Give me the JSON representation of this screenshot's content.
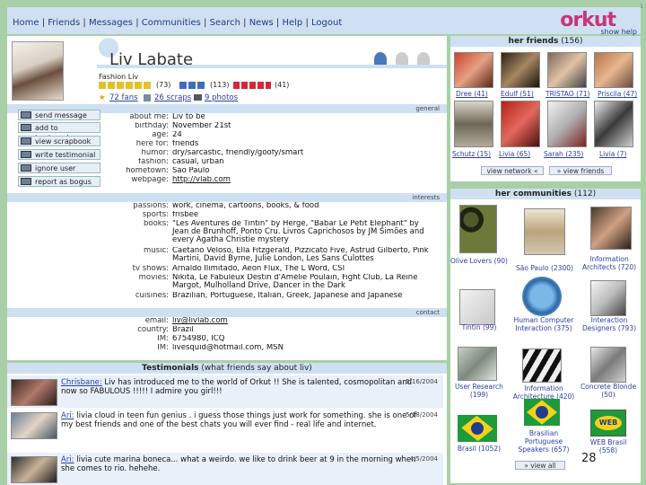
{
  "nav": {
    "items": [
      "Home",
      "Friends",
      "Messages",
      "Communities",
      "Search",
      "News",
      "Help",
      "Logout"
    ],
    "logo": "orkut",
    "help": "show help",
    "side": "1"
  },
  "profile": {
    "name": "Liv Labate",
    "hdr1": "",
    "meta1": "Fashion Liv",
    "fans_count": "(73)",
    "cool_count": "(113)",
    "sexy_count": "(41)",
    "fans": "72 fans",
    "scraps": "26 scraps",
    "photos": "9 photos",
    "section_general": "general",
    "section_interests": "interests",
    "section_contact": "contact"
  },
  "actions": [
    "send message",
    "add to bookmarks",
    "view scrapbook",
    "write testimonial",
    "ignore user",
    "report as bogus"
  ],
  "general": [
    {
      "k": "about me:",
      "v": "Liv to be"
    },
    {
      "k": "birthday:",
      "v": "November 21st"
    },
    {
      "k": "age:",
      "v": "24"
    },
    {
      "k": "here for:",
      "v": "friends"
    },
    {
      "k": "humor:",
      "v": "dry/sarcastic, friendly/goofy/smart"
    },
    {
      "k": "fashion:",
      "v": "casual, urban"
    },
    {
      "k": "hometown:",
      "v": "São Paulo"
    },
    {
      "k": "webpage:",
      "v": "http://vlab.com"
    }
  ],
  "interests": [
    {
      "k": "passions:",
      "v": "work, cinema, cartoons, books, & food"
    },
    {
      "k": "sports:",
      "v": "frisbee"
    },
    {
      "k": "books:",
      "v": "\"Les Aventures de Tintin\" by Hergé, \"Babar Le Petit Elephant\" by Jean de Brunhoff, Ponto Cru. Livros Caprichosos by JM Simões and every Agatha Christie mystery"
    },
    {
      "k": "music:",
      "v": "Caetano Veloso, Ella Fitzgerald, Pizzicato Five, Astrud Gilberto, Pink Martini, David Byrne, Julie London, Les Sans Culottes"
    },
    {
      "k": "tv shows:",
      "v": "Arnaldo Ilimitado, Aeon Flux, The L Word, CSI"
    },
    {
      "k": "movies:",
      "v": "Nikita, Le Fabuleux Destin d'Amélie Poulain, Fight Club, La Reine Margot, Mulholland Drive, Dancer in the Dark"
    },
    {
      "k": "cuisines:",
      "v": "Brazilian, Portuguese, Italian, Greek, Japanese and Japanese"
    }
  ],
  "contact": [
    {
      "k": "email:",
      "v": "liv@livlab.com"
    },
    {
      "k": "country:",
      "v": "Brazil"
    },
    {
      "k": "IM:",
      "v": "6754980, ICQ"
    },
    {
      "k": "IM:",
      "v": "livesquid@hotmail.com, MSN"
    }
  ],
  "testimonials": {
    "title": "Testimonials",
    "subtitle": "(what friends say about liv)",
    "items": [
      {
        "author": "Chrisbane:",
        "text": "Liv has introduced me to the world of Orkut !! She is talented, cosmopolitan and now so FABULOUS !!!!! I admire you girl!!!",
        "date": "5/16/2004"
      },
      {
        "author": "Ari:",
        "text": "livia cloud in teen fun genius . i guess those things just work for something. she is one of my best friends and one of the best chats you will ever find - real life and internet.",
        "date": "5/18/2004"
      },
      {
        "author": "Ari:",
        "text": "livia cute marina boneca... what a weirdo. we like to drink beer at 9 in the morning when she comes to rio. hehehe.",
        "date": "4/5/2004"
      }
    ]
  },
  "friends": {
    "title": "her friends",
    "count": "(156)",
    "items": [
      {
        "name": "Dree",
        "n": "(41)"
      },
      {
        "name": "Edulf",
        "n": "(51)"
      },
      {
        "name": "TRISTAO",
        "n": "(71)"
      },
      {
        "name": "Priscila",
        "n": "(47)"
      },
      {
        "name": "Schutz",
        "n": "(15)"
      },
      {
        "name": "Livia",
        "n": "(65)"
      },
      {
        "name": "Sarah",
        "n": "(235)"
      },
      {
        "name": "Livia",
        "n": "(7)"
      }
    ],
    "view_network": "view network",
    "view_friends": "view friends"
  },
  "communities": {
    "title": "her communities",
    "count": "(112)",
    "items": [
      {
        "name": "Olive Lovers",
        "n": "(90)"
      },
      {
        "name": "São Paulo",
        "n": "(2300)"
      },
      {
        "name": "Information Architects",
        "n": "(720)"
      },
      {
        "name": "Tintin",
        "n": "(99)"
      },
      {
        "name": "Human Computer Interaction",
        "n": "(375)"
      },
      {
        "name": "Interaction Designers",
        "n": "(793)"
      },
      {
        "name": "User Research",
        "n": "(199)"
      },
      {
        "name": "Information Architecture",
        "n": "(420)"
      },
      {
        "name": "Concrete Blonde",
        "n": "(50)"
      },
      {
        "name": "Brasil",
        "n": "(1052)"
      },
      {
        "name": "Brasilian Portuguese Speakers",
        "n": "(657)"
      },
      {
        "name": "WEB Brasil",
        "n": "(558)"
      }
    ],
    "view_all": "view all"
  },
  "page_number": "28"
}
